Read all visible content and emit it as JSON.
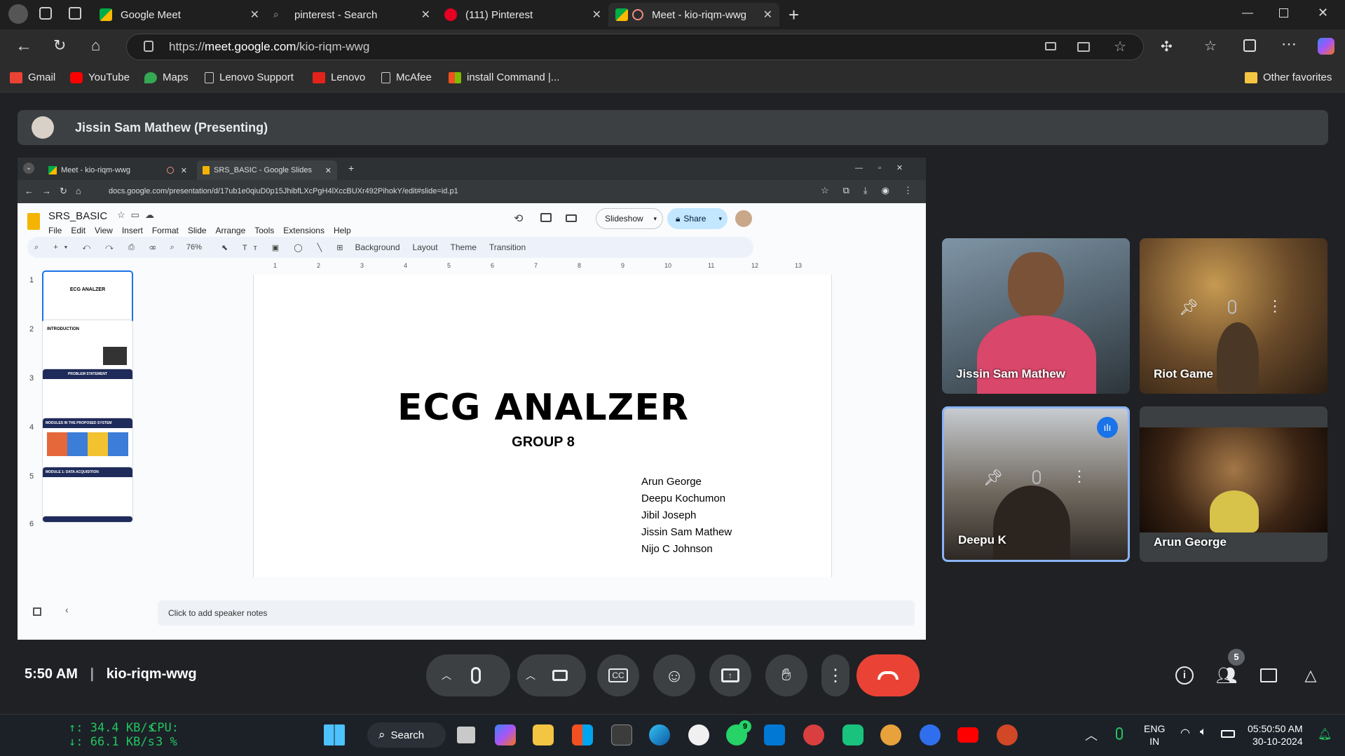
{
  "browser": {
    "tabs": [
      {
        "title": "Google Meet"
      },
      {
        "title": "pinterest - Search"
      },
      {
        "title": "(111) Pinterest"
      },
      {
        "title": "Meet - kio-riqm-wwg"
      }
    ],
    "url_prefix": "https://",
    "url_host": "meet.google.com",
    "url_path": "/kio-riqm-wwg",
    "favorites": [
      "Gmail",
      "YouTube",
      "Maps",
      "Lenovo Support",
      "Lenovo",
      "McAfee",
      "install Command |...",
      "Other favorites"
    ]
  },
  "meet": {
    "presenter_label": "Jissin Sam Mathew (Presenting)",
    "time": "5:50 AM",
    "meeting_code": "kio-riqm-wwg",
    "people_count": "5",
    "participants": [
      {
        "name": "Jissin Sam Mathew"
      },
      {
        "name": "Riot Game"
      },
      {
        "name": "Deepu K"
      },
      {
        "name": "Arun George"
      }
    ],
    "colors": {
      "end_call": "#ea4335",
      "active_speaker": "#8ab4f8",
      "accent": "#1a73e8"
    }
  },
  "shared_screen": {
    "tabs": [
      "Meet - kio-riqm-wwg",
      "SRS_BASIC - Google Slides"
    ],
    "url": "docs.google.com/presentation/d/17ub1e0qiuD0p15JhibfLXcPgH4lXccBUXr492PihokY/edit#slide=id.p1",
    "doc_title": "SRS_BASIC",
    "menu": [
      "File",
      "Edit",
      "View",
      "Insert",
      "Format",
      "Slide",
      "Arrange",
      "Tools",
      "Extensions",
      "Help"
    ],
    "slideshow_label": "Slideshow",
    "share_label": "Share",
    "zoom": "76%",
    "toolbar": [
      "Background",
      "Layout",
      "Theme",
      "Transition"
    ],
    "ruler": [
      "1",
      "2",
      "3",
      "4",
      "5",
      "6",
      "7",
      "8",
      "9",
      "10",
      "11",
      "12",
      "13"
    ],
    "thumbnails": [
      {
        "num": "1",
        "title": "ECG ANALZER"
      },
      {
        "num": "2",
        "title": "INTRODUCTION"
      },
      {
        "num": "3",
        "title": "PROBLEM STATEMENT"
      },
      {
        "num": "4",
        "title": "MODULES IN THE PROPOSED SYSTEM"
      },
      {
        "num": "5",
        "title": "MODULE 1: DATA ACQUISITION"
      },
      {
        "num": "6",
        "title": ""
      }
    ],
    "slide": {
      "title": "ECG ANALZER",
      "subtitle": "GROUP 8",
      "members": [
        "Arun George",
        "Deepu Kochumon",
        "Jibil Joseph",
        "Jissin Sam Mathew",
        "Nijo C Johnson"
      ]
    },
    "notes_placeholder": "Click to add speaker notes"
  },
  "taskbar": {
    "net_up": "↑: 34.4 KB/s",
    "net_down": "↓: 66.1 KB/s",
    "cpu_label": "CPU:",
    "cpu_value": "3 %",
    "search_label": "Search",
    "whatsapp_badge": "9",
    "lang_top": "ENG",
    "lang_bottom": "IN",
    "clock_time": "05:50:50 AM",
    "clock_date": "30-10-2024"
  }
}
